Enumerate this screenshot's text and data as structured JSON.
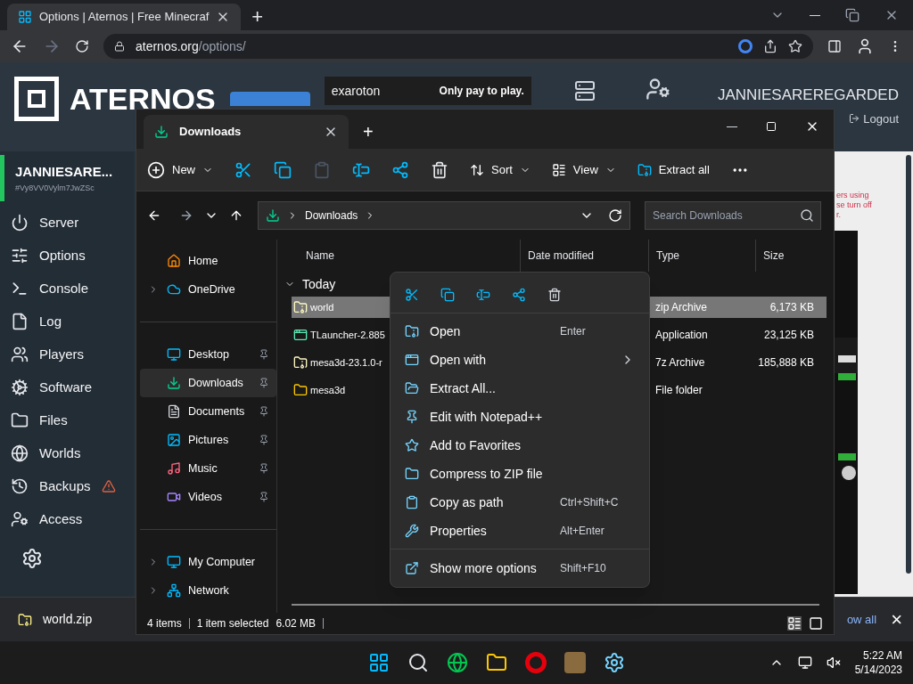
{
  "browser": {
    "tab_title": "Options | Aternos | Free Minecraf",
    "new_tab": "+",
    "url_host": "aternos.org",
    "url_path": "/options/"
  },
  "aternos": {
    "logo": "ATERNOS",
    "ad_brand": "exaroton",
    "ad_tagline": "Only pay to play.",
    "username": "JANNIESAREREGARDED",
    "logout": "Logout",
    "server_name": "JANNIESARE...",
    "server_id": "#Vy8VV0Vylm7JwZSc",
    "nav": [
      {
        "label": "Server",
        "warning": false
      },
      {
        "label": "Options",
        "warning": false
      },
      {
        "label": "Console",
        "warning": false
      },
      {
        "label": "Log",
        "warning": false
      },
      {
        "label": "Players",
        "warning": false
      },
      {
        "label": "Software",
        "warning": false
      },
      {
        "label": "Files",
        "warning": false
      },
      {
        "label": "Worlds",
        "warning": false
      },
      {
        "label": "Backups",
        "warning": true
      },
      {
        "label": "Access",
        "warning": false
      }
    ],
    "notice": [
      "ers using",
      "se turn off",
      "r."
    ]
  },
  "downloads_bar": {
    "file": "world.zip",
    "show_all": "ow all",
    "close": "×"
  },
  "explorer": {
    "tab": "Downloads",
    "new_tab": "+",
    "toolbar": {
      "new": "New",
      "sort": "Sort",
      "view": "View",
      "extract": "Extract all",
      "paste_disabled": true
    },
    "breadcrumb": "Downloads",
    "search_placeholder": "Search Downloads",
    "nav_groups": [
      [
        {
          "label": "Home",
          "selected": false,
          "expandable": false,
          "pinned": false
        },
        {
          "label": "OneDrive",
          "selected": false,
          "expandable": true,
          "pinned": false
        }
      ],
      [
        {
          "label": "Desktop",
          "selected": false,
          "expandable": false,
          "pinned": true
        },
        {
          "label": "Downloads",
          "selected": true,
          "expandable": false,
          "pinned": true
        },
        {
          "label": "Documents",
          "selected": false,
          "expandable": false,
          "pinned": true
        },
        {
          "label": "Pictures",
          "selected": false,
          "expandable": false,
          "pinned": true
        },
        {
          "label": "Music",
          "selected": false,
          "expandable": false,
          "pinned": true
        },
        {
          "label": "Videos",
          "selected": false,
          "expandable": false,
          "pinned": true
        }
      ],
      [
        {
          "label": "My Computer",
          "selected": false,
          "expandable": true,
          "pinned": false
        },
        {
          "label": "Network",
          "selected": false,
          "expandable": true,
          "pinned": false
        }
      ]
    ],
    "columns": [
      "Name",
      "Date modified",
      "Type",
      "Size"
    ],
    "group": "Today",
    "files": [
      {
        "name": "world",
        "type": "zip Archive",
        "size": "6,173 KB",
        "selected": true
      },
      {
        "name": "TLauncher-2.885",
        "type": "Application",
        "size": "23,125 KB",
        "selected": false
      },
      {
        "name": "mesa3d-23.1.0-r",
        "type": "7z Archive",
        "size": "185,888 KB",
        "selected": false
      },
      {
        "name": "mesa3d",
        "type": "File folder",
        "selected": false
      }
    ],
    "status": {
      "count": "4 items",
      "selection": "1 item selected",
      "size": "6.02 MB"
    }
  },
  "context_menu": {
    "items": [
      {
        "label": "Open",
        "shortcut": "Enter",
        "submenu": false
      },
      {
        "label": "Open with",
        "submenu": true
      },
      {
        "label": "Extract All...",
        "submenu": false
      },
      {
        "label": "Edit with Notepad++",
        "submenu": false
      },
      {
        "label": "Add to Favorites",
        "submenu": false
      },
      {
        "label": "Compress to ZIP file",
        "submenu": false
      },
      {
        "label": "Copy as path",
        "shortcut": "Ctrl+Shift+C",
        "submenu": false
      },
      {
        "label": "Properties",
        "shortcut": "Alt+Enter",
        "submenu": false
      }
    ],
    "more": {
      "label": "Show more options",
      "shortcut": "Shift+F10"
    }
  },
  "taskbar": {
    "time": "5:22 AM",
    "date": "5/14/2023"
  }
}
